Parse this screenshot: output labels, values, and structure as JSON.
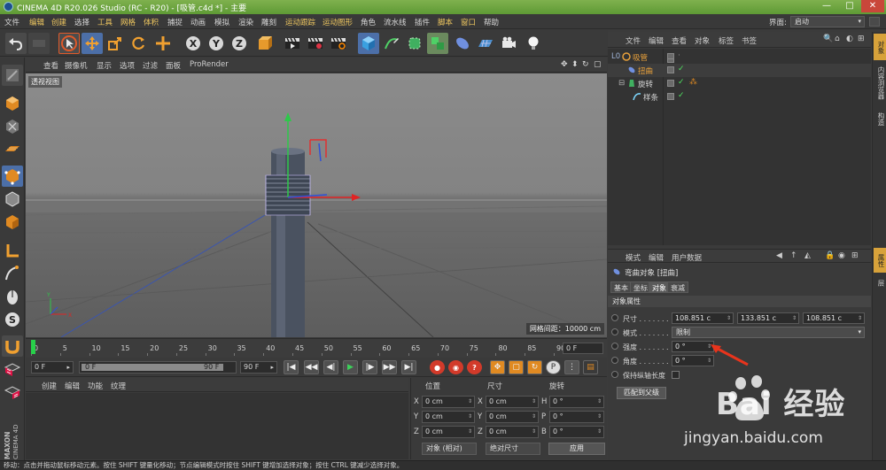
{
  "window": {
    "title": "CINEMA 4D R20.026 Studio (RC - R20) - [吸管.c4d *] - 主要",
    "buttons": [
      "—",
      "□",
      "✕"
    ]
  },
  "menu": {
    "items": [
      "文件",
      "编辑",
      "创建",
      "选择",
      "工具",
      "网格",
      "体积",
      "捕捉",
      "动画",
      "模拟",
      "渲染",
      "雕刻",
      "运动跟踪",
      "运动图形",
      "角色",
      "流水线",
      "插件",
      "脚本",
      "窗口",
      "帮助"
    ],
    "layout_label": "界面:",
    "layout_value": "启动"
  },
  "toolbar": {
    "icons": [
      "undo-icon",
      "redo-icon",
      "live-select-icon",
      "move-icon",
      "scale-icon",
      "rotate-icon",
      "last-tool-icon",
      "x-axis-icon",
      "y-axis-icon",
      "z-axis-icon",
      "coordinate-system-icon",
      "render-view-icon",
      "render-picture-queue-icon",
      "render-settings-icon",
      "cube-icon",
      "pen-spline-icon",
      "subdivision-icon",
      "array-icon",
      "deformer-icon",
      "floor-icon",
      "camera-icon",
      "light-icon"
    ],
    "xyz": [
      "X",
      "Y",
      "Z"
    ]
  },
  "left_tools": [
    "model-mode-icon",
    "mesh-checker-icon",
    "texture-mode-icon",
    "workplane-icon",
    "points-mode-icon",
    "edges-mode-icon",
    "polygons-mode-icon",
    "axis-mode-icon",
    "tweak-mode-icon",
    "soft-selection-icon",
    "snap-icon",
    "snap-settings-icon",
    "locked-workplane-icon"
  ],
  "viewport": {
    "menu": [
      "查看",
      "摄像机",
      "显示",
      "选项",
      "过滤",
      "面板",
      "ProRender"
    ],
    "label": "透视视图",
    "grid_info": "网格间距：10000 cm",
    "nav_icons": [
      "✥",
      "⬍",
      "↻",
      "▢"
    ]
  },
  "timeline": {
    "ticks": [
      "0",
      "5",
      "10",
      "15",
      "20",
      "25",
      "30",
      "35",
      "40",
      "45",
      "50",
      "55",
      "60",
      "65",
      "70",
      "75",
      "80",
      "85",
      "90"
    ],
    "current": "0 F",
    "playhead_frame": 0,
    "max_frame": 90
  },
  "transport": {
    "start": "0 F",
    "range_start": "0 F",
    "range_end": "90 F",
    "end": "90 F",
    "buttons": [
      "|◀",
      "◀◀",
      "◀|",
      "▶",
      "|▶",
      "▶▶",
      "▶|"
    ],
    "key_buttons": [
      "record-icon",
      "autokey-icon",
      "keyframe-selection-icon"
    ],
    "key_labels": [
      "●",
      "◉",
      "?"
    ]
  },
  "materials": {
    "menu": [
      "创建",
      "编辑",
      "功能",
      "纹理"
    ]
  },
  "coordinates": {
    "headers": {
      "position": "位置",
      "size": "尺寸",
      "rotation": "旋转"
    },
    "rows": [
      {
        "axis": "X",
        "pos": "0 cm",
        "size_axis": "X",
        "size": "0 cm",
        "rot_axis": "H",
        "rot": "0 °"
      },
      {
        "axis": "Y",
        "pos": "0 cm",
        "size_axis": "Y",
        "size": "0 cm",
        "rot_axis": "P",
        "rot": "0 °"
      },
      {
        "axis": "Z",
        "pos": "0 cm",
        "size_axis": "Z",
        "size": "0 cm",
        "rot_axis": "B",
        "rot": "0 °"
      }
    ],
    "mode": "对象 (相对)",
    "size_mode": "绝对尺寸",
    "apply": "应用"
  },
  "status": "移动：点击并拖动鼠标移动元素。按住 SHIFT 键量化移动；节点编辑模式时按住 SHIFT 键增加选择对象；按住 CTRL 键减少选择对象。",
  "object_manager": {
    "menu": [
      "文件",
      "编辑",
      "查看",
      "对象",
      "标签",
      "书签"
    ],
    "icons": [
      "🔍",
      "⌂",
      "◐",
      "⊞"
    ],
    "objects": [
      {
        "name": "吸管",
        "depth": 0,
        "color": "#e9a13b",
        "icon": "null-icon",
        "prefix": "L0",
        "selected": false
      },
      {
        "name": "扭曲",
        "depth": 1,
        "color": "#d5d5d5",
        "icon": "twist-deformer-icon",
        "prefix": "",
        "selected": true
      },
      {
        "name": "旋转",
        "depth": 1,
        "color": "#d5d5d5",
        "icon": "lathe-icon",
        "prefix": "",
        "selected": false
      },
      {
        "name": "样条",
        "depth": 2,
        "color": "#d5d5d5",
        "icon": "spline-icon",
        "prefix": "",
        "selected": false
      }
    ]
  },
  "right_tabs": [
    "对象",
    "内容浏览器",
    "构造",
    "属性",
    "层"
  ],
  "attributes": {
    "menu": [
      "模式",
      "编辑",
      "用户数据"
    ],
    "nav_icons": [
      "◀",
      "↑",
      "◭",
      "🔒",
      "◉",
      "⊞"
    ],
    "object_title": "弯曲对象 [扭曲]",
    "tabs": [
      "基本",
      "坐标",
      "对象",
      "衰减"
    ],
    "active_tab": "对象",
    "section": "对象属性",
    "size_label": "尺寸",
    "size_values": [
      "108.851 c",
      "133.851 c",
      "108.851 c"
    ],
    "mode_label": "模式",
    "mode_value": "限制",
    "strength_label": "强度",
    "strength_value": "0 °",
    "angle_label": "角度",
    "angle_value": "0 °",
    "keep_length_label": "保持纵轴长度",
    "fit_button": "匹配到父级"
  },
  "watermark": {
    "brand": "Bai 经验",
    "url": "jingyan.baidu.com"
  },
  "logo_text": "MAXON CINEMA 4D"
}
